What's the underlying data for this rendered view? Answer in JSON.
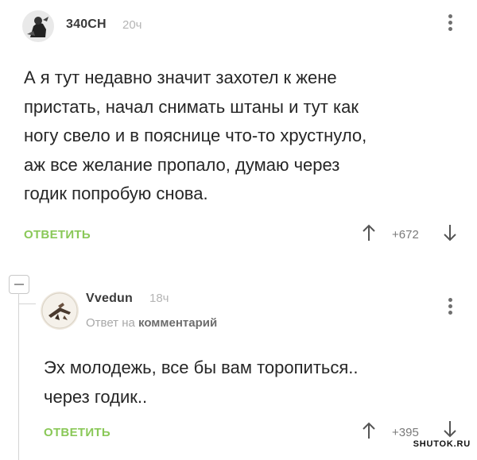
{
  "comments": [
    {
      "username": "340CH",
      "time": "20ч",
      "lines": [
        "А я тут недавно значит захотел к жене",
        "пристать, начал снимать штаны и тут как",
        "ногу свело и в пояснице что-то хрустнуло,",
        "аж все желание пропало, думаю через",
        "годик попробую снова."
      ],
      "reply_label": "ОТВЕТИТЬ",
      "rating": "+672"
    },
    {
      "username": "Vvedun",
      "time": "18ч",
      "reply_to_prefix": "Ответ на",
      "reply_to_target": "комментарий",
      "lines": [
        "Эх молодежь, все бы вам торопиться..",
        "через годик.."
      ],
      "reply_label": "ОТВЕТИТЬ",
      "rating": "+395"
    }
  ],
  "icons": {
    "more": "more-vertical-icon",
    "upvote": "arrow-up-icon",
    "downvote": "arrow-down-icon",
    "collapse": "collapse-minus-icon"
  },
  "colors": {
    "reply_green": "#8ac858",
    "muted": "#b5b5b5",
    "text": "#262626"
  },
  "watermark": "SHUTOK.RU"
}
